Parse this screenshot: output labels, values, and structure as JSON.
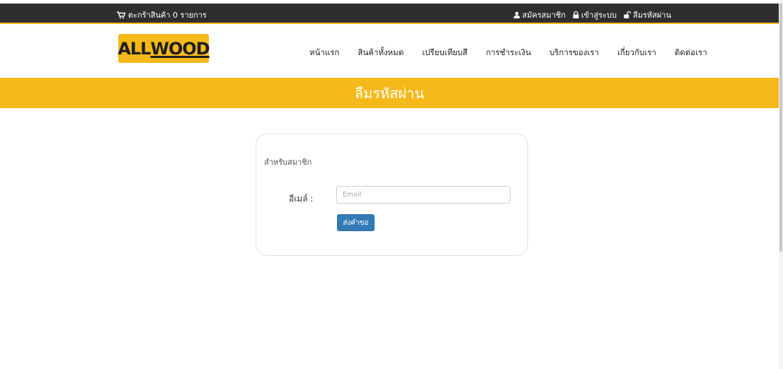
{
  "topbar": {
    "cart_label": "ตะกร้าสินค้า 0 รายการ",
    "register": "สมัครสมาชิก",
    "login": "เข้าสู่ระบบ",
    "forgot": "ลืมรหัสผ่าน"
  },
  "logo": {
    "text_a": "ALL",
    "text_b": "WOOD"
  },
  "nav": {
    "items": [
      "หน้าแรก",
      "สินค้าทั้งหมด",
      "เปรียบเทียบสี",
      "การชำระเงิน",
      "บริการของเรา",
      "เกี่ยวกับเรา",
      "ติดต่อเรา"
    ]
  },
  "banner": {
    "title": "ลืมรหัสผ่าน"
  },
  "form": {
    "subtitle": "สำหรับสมาชิก",
    "email_label": "อีเมล์ :",
    "email_placeholder": "Email",
    "email_value": "",
    "submit_label": "ส่งคำขอ"
  },
  "colors": {
    "accent": "#f6b91a",
    "topbar": "#2e2e2e",
    "button": "#337ab7"
  }
}
